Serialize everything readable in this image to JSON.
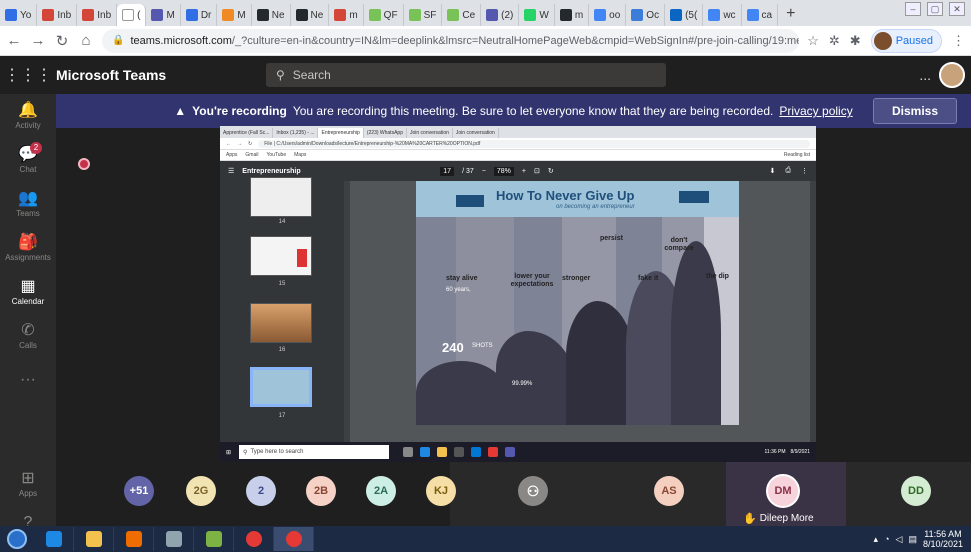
{
  "browser": {
    "tabs": [
      {
        "label": "Yo",
        "icon": "s-icon",
        "color": "#2f6ee5"
      },
      {
        "label": "Inb",
        "icon": "gmail-icon",
        "color": "#d44638"
      },
      {
        "label": "Inb",
        "icon": "gmail-icon",
        "color": "#d44638"
      },
      {
        "label": "(",
        "icon": "speaker-icon",
        "color": "#ffffff",
        "active": true
      },
      {
        "label": "M",
        "icon": "teams-icon",
        "color": "#5558af"
      },
      {
        "label": "Dr",
        "icon": "s-icon",
        "color": "#2f6ee5"
      },
      {
        "label": "M",
        "icon": "circle-icon",
        "color": "#f08a24"
      },
      {
        "label": "Ne",
        "icon": "github-icon",
        "color": "#24292e"
      },
      {
        "label": "Ne",
        "icon": "github-icon",
        "color": "#24292e"
      },
      {
        "label": "m",
        "icon": "gmail-icon",
        "color": "#d44638"
      },
      {
        "label": "QF",
        "icon": "android-icon",
        "color": "#78c257"
      },
      {
        "label": "SF",
        "icon": "android-icon",
        "color": "#78c257"
      },
      {
        "label": "Ce",
        "icon": "android-icon",
        "color": "#78c257"
      },
      {
        "label": "(2)",
        "icon": "teams-icon",
        "color": "#5558af"
      },
      {
        "label": "W",
        "icon": "whatsapp-icon",
        "color": "#25d366"
      },
      {
        "label": "m",
        "icon": "github-icon",
        "color": "#24292e"
      },
      {
        "label": "oo",
        "icon": "google-icon",
        "color": "#4285f4"
      },
      {
        "label": "Oc",
        "icon": "download-icon",
        "color": "#3b7dd8"
      },
      {
        "label": "(5(",
        "icon": "linkedin-icon",
        "color": "#0a66c2"
      },
      {
        "label": "wc",
        "icon": "google-icon",
        "color": "#4285f4"
      },
      {
        "label": "ca",
        "icon": "google-icon",
        "color": "#4285f4"
      }
    ],
    "new_tab": "+",
    "url_host": "teams.microsoft.com",
    "url_path": "/_?culture=en-in&country=IN&lm=deeplink&lmsrc=NeutralHomePageWeb&cmpid=WebSignIn#/pre-join-calling/19:meeting_MW...",
    "paused_label": "Paused"
  },
  "teams": {
    "app_name": "Microsoft Teams",
    "search_placeholder": "Search",
    "more": "...",
    "rail": [
      {
        "label": "Activity",
        "icon": "bell-icon"
      },
      {
        "label": "Chat",
        "icon": "chat-icon",
        "badge": "2"
      },
      {
        "label": "Teams",
        "icon": "teams-icon"
      },
      {
        "label": "Assignments",
        "icon": "assignments-icon"
      },
      {
        "label": "Calendar",
        "icon": "calendar-icon",
        "active": true
      },
      {
        "label": "Calls",
        "icon": "phone-icon"
      },
      {
        "label": "...",
        "icon": "ellipsis-icon"
      }
    ],
    "rail_bottom": [
      {
        "label": "Apps",
        "icon": "apps-icon"
      },
      {
        "label": "Help",
        "icon": "help-icon"
      }
    ]
  },
  "recording_banner": {
    "heading": "You're recording",
    "message": "You are recording this meeting. Be sure to let everyone know that they are being recorded.",
    "link": "Privacy policy",
    "dismiss": "Dismiss"
  },
  "shared_screen": {
    "tabs": [
      "Apprentice (Fall Sc...",
      "Inbox (1,235) - ...",
      "Entrepreneurship",
      "(223) WhatsApp",
      "Join conversation",
      "Join conversation"
    ],
    "url": "File | C:/Users/admin/Downloads/lecture/Entrepreneurship-%20MA%20CARTER%20OPTION.pdf",
    "bookmarks": [
      "Apps",
      "Gmail",
      "YouTube",
      "Maps"
    ],
    "reading_list": "Reading list",
    "pdf_title": "Entrepreneurship",
    "page_current": "17",
    "page_total": "/ 37",
    "zoom": "78%",
    "thumb_numbers": [
      "14",
      "15",
      "16",
      "17"
    ],
    "page": {
      "title": "How To Never Give Up",
      "subtitle": "on becoming an entrepreneur",
      "steps": [
        "stay alive",
        "lower your expectations",
        "stronger",
        "persist",
        "fake it",
        "don't compare",
        "the dip"
      ],
      "age": "60 years,",
      "shots": "240",
      "shots_label": "SHOTS",
      "pct": "99.99%"
    },
    "taskbar_search": "Type here to search",
    "taskbar_time": "11:36 PM",
    "taskbar_date": "8/9/2021"
  },
  "participants": [
    {
      "initials": "+51",
      "color": "#6264a7",
      "text_color": "#ffffff"
    },
    {
      "initials": "2G",
      "color": "#f2e3b3",
      "text_color": "#7a6328"
    },
    {
      "initials": "2",
      "color": "#c8cfea",
      "text_color": "#3b4a8a"
    },
    {
      "initials": "2B",
      "color": "#f6d2c6",
      "text_color": "#8a4632"
    },
    {
      "initials": "2A",
      "color": "#cdeee4",
      "text_color": "#2b6b58"
    },
    {
      "initials": "KJ",
      "color": "#f5dfa6",
      "text_color": "#7a5c10"
    },
    {
      "initials": "",
      "color": "#8a8886",
      "text_color": "#ffffff",
      "icon": "person-icon"
    },
    {
      "initials": "AS",
      "color": "#f4cfc0",
      "text_color": "#8a4632"
    },
    {
      "initials": "DM",
      "color": "#f7d4dc",
      "text_color": "#8a3246",
      "speaking": true,
      "name": "Dileep More"
    },
    {
      "initials": "DD",
      "color": "#d4ecd1",
      "text_color": "#2f6a2a"
    }
  ],
  "taskbar": {
    "apps": [
      {
        "icon": "ie-icon",
        "color": "#1e88e5"
      },
      {
        "icon": "folder-icon",
        "color": "#f2c14e"
      },
      {
        "icon": "media-icon",
        "color": "#ef6c00"
      },
      {
        "icon": "snip-icon",
        "color": "#90a4ae"
      },
      {
        "icon": "paint-icon",
        "color": "#7cb342"
      },
      {
        "icon": "chrome-icon",
        "color": "#e53935"
      },
      {
        "icon": "chrome-icon",
        "color": "#e53935",
        "active": true
      }
    ],
    "time": "11:56 AM",
    "date": "8/10/2021"
  }
}
